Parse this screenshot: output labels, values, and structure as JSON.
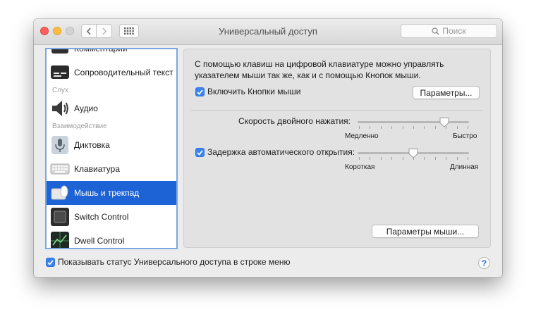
{
  "window": {
    "title": "Универсальный доступ",
    "search_placeholder": "Поиск"
  },
  "sidebar": {
    "partial_item": "Комментарии",
    "items": [
      {
        "label": "Сопроводительный текст"
      },
      {
        "label": "Аудио"
      },
      {
        "label": "Диктовка"
      },
      {
        "label": "Клавиатура"
      },
      {
        "label": "Мышь и трекпад",
        "selected": true
      },
      {
        "label": "Switch Control"
      },
      {
        "label": "Dwell Control"
      }
    ],
    "headers": {
      "hearing": "Слух",
      "interaction": "Взаимодействие"
    }
  },
  "panel": {
    "description_line1": "С помощью клавиш на цифровой клавиатуре можно управлять",
    "description_line2": "указателем мыши так же, как и с помощью Кнопок мыши.",
    "mouse_keys_label": "Включить Кнопки мыши",
    "mouse_keys_checked": true,
    "options_button": "Параметры...",
    "double_click": {
      "label": "Скорость двойного нажатия:",
      "min_label": "Медленно",
      "max_label": "Быстро",
      "value_fraction": 0.78
    },
    "spring_loading": {
      "label": "Задержка автоматического открытия:",
      "checked": true,
      "min_label": "Короткая",
      "max_label": "Длинная",
      "value_fraction": 0.5
    },
    "mouse_options_button": "Параметры мыши..."
  },
  "footer": {
    "show_status_label": "Показывать статус Универсального доступа в строке меню",
    "show_status_checked": true,
    "help": "?"
  },
  "colors": {
    "accent": "#1d63d6",
    "checkbox": "#3b84f0",
    "close": "#fc605c",
    "minimize": "#fdbc40"
  }
}
